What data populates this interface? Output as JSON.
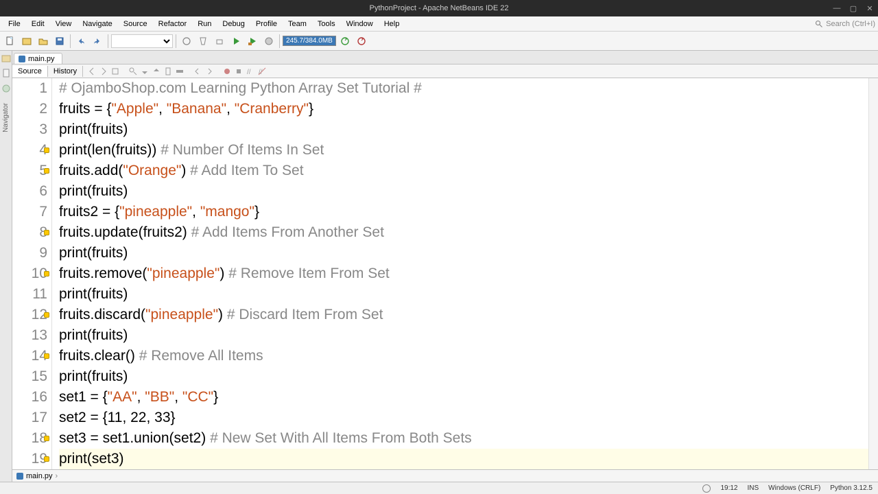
{
  "title": "PythonProject - Apache NetBeans IDE 22",
  "menu": [
    "File",
    "Edit",
    "View",
    "Navigate",
    "Source",
    "Refactor",
    "Run",
    "Debug",
    "Profile",
    "Team",
    "Tools",
    "Window",
    "Help"
  ],
  "search_placeholder": "Search (Ctrl+I)",
  "memory": "245.7/384.0MB",
  "file_tab": "main.py",
  "sub_tabs": {
    "source": "Source",
    "history": "History"
  },
  "gutter": {
    "hint_lines": [
      4,
      5,
      8,
      10,
      12,
      14,
      18,
      19
    ]
  },
  "code": [
    {
      "n": 1,
      "seg": [
        [
          "c",
          "# OjamboShop.com Learning Python Array Set Tutorial #"
        ]
      ]
    },
    {
      "n": 2,
      "seg": [
        [
          "n",
          "fruits = {"
        ],
        [
          "s",
          "\"Apple\""
        ],
        [
          "n",
          ", "
        ],
        [
          "s",
          "\"Banana\""
        ],
        [
          "n",
          ", "
        ],
        [
          "s",
          "\"Cranberry\""
        ],
        [
          "n",
          "}"
        ]
      ]
    },
    {
      "n": 3,
      "seg": [
        [
          "n",
          "print(fruits)"
        ]
      ]
    },
    {
      "n": 4,
      "seg": [
        [
          "n",
          "print(len(fruits)) "
        ],
        [
          "c",
          "# Number Of Items In Set"
        ]
      ]
    },
    {
      "n": 5,
      "seg": [
        [
          "n",
          "fruits.add("
        ],
        [
          "s",
          "\"Orange\""
        ],
        [
          "n",
          ") "
        ],
        [
          "c",
          "# Add Item To Set"
        ]
      ]
    },
    {
      "n": 6,
      "seg": [
        [
          "n",
          "print(fruits)"
        ]
      ]
    },
    {
      "n": 7,
      "seg": [
        [
          "n",
          "fruits2 = {"
        ],
        [
          "s",
          "\"pineapple\""
        ],
        [
          "n",
          ", "
        ],
        [
          "s",
          "\"mango\""
        ],
        [
          "n",
          "}"
        ]
      ]
    },
    {
      "n": 8,
      "seg": [
        [
          "n",
          "fruits.update(fruits2) "
        ],
        [
          "c",
          "# Add Items From Another Set"
        ]
      ]
    },
    {
      "n": 9,
      "seg": [
        [
          "n",
          "print(fruits)"
        ]
      ]
    },
    {
      "n": 10,
      "seg": [
        [
          "n",
          "fruits.remove("
        ],
        [
          "s",
          "\"pineapple\""
        ],
        [
          "n",
          ") "
        ],
        [
          "c",
          "# Remove Item From Set"
        ]
      ]
    },
    {
      "n": 11,
      "seg": [
        [
          "n",
          "print(fruits)"
        ]
      ]
    },
    {
      "n": 12,
      "seg": [
        [
          "n",
          "fruits.discard("
        ],
        [
          "s",
          "\"pineapple\""
        ],
        [
          "n",
          ") "
        ],
        [
          "c",
          "# Discard Item From Set"
        ]
      ]
    },
    {
      "n": 13,
      "seg": [
        [
          "n",
          "print(fruits)"
        ]
      ]
    },
    {
      "n": 14,
      "seg": [
        [
          "n",
          "fruits.clear() "
        ],
        [
          "c",
          "# Remove All Items"
        ]
      ]
    },
    {
      "n": 15,
      "seg": [
        [
          "n",
          "print(fruits)"
        ]
      ]
    },
    {
      "n": 16,
      "seg": [
        [
          "n",
          "set1 = {"
        ],
        [
          "s",
          "\"AA\""
        ],
        [
          "n",
          ", "
        ],
        [
          "s",
          "\"BB\""
        ],
        [
          "n",
          ", "
        ],
        [
          "s",
          "\"CC\""
        ],
        [
          "n",
          "}"
        ]
      ]
    },
    {
      "n": 17,
      "seg": [
        [
          "n",
          "set2 = {11, 22, 33}"
        ]
      ]
    },
    {
      "n": 18,
      "seg": [
        [
          "n",
          "set3 = set1.union(set2) "
        ],
        [
          "c",
          "# New Set With All Items From Both Sets"
        ]
      ]
    },
    {
      "n": 19,
      "seg": [
        [
          "n",
          "print(set3)"
        ]
      ]
    }
  ],
  "current_line": 19,
  "breadcrumb": "main.py",
  "status": {
    "cursor": "19:12",
    "ins": "INS",
    "enc": "Windows (CRLF)",
    "py": "Python 3.12.5"
  },
  "side_labels": [
    "Navigator",
    "Services",
    "Files",
    "Projects"
  ]
}
